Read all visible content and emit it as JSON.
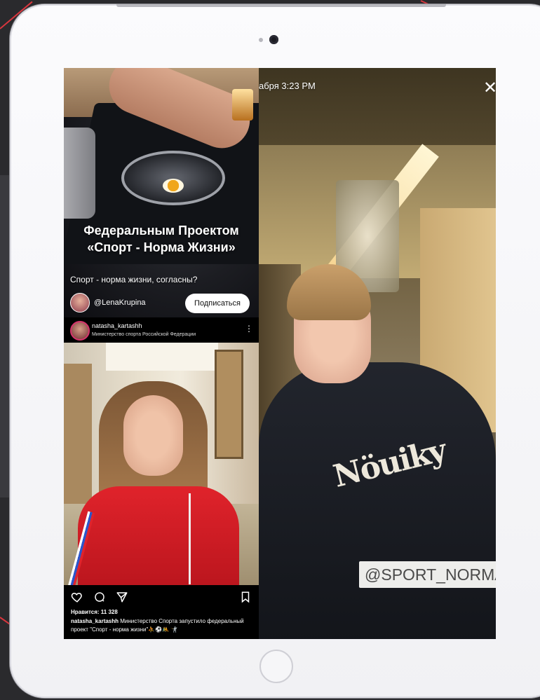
{
  "reel": {
    "title_line1": "Федеральным Проектом",
    "title_line2": "«Спорт - Норма Жизни»",
    "subtitle": "Спорт - норма жизни, согласны?",
    "author": "@LenaKrupina",
    "subscribe_label": "Подписаться"
  },
  "post": {
    "username": "natasha_kartashh",
    "subtitle": "Министерство спорта Российской Федерации",
    "more_icon": "⋮",
    "likes": "Нравится: 11 328",
    "caption_user": "natasha_kartashh",
    "caption_text": " Министерство Спорта запустило федеральный проект \"Спорт - норма жизни\"⛹️⚽🤼 🤺"
  },
  "story": {
    "timestamp": "абря  3:23 PM",
    "close_icon": "✕",
    "tag": "@SPORT_NORMA",
    "hoodie_print": "Nöuiky"
  },
  "colors": {
    "accent": "#d9363e",
    "subscribe_bg": "#ffffff",
    "tag_bg": "#ededeb"
  }
}
